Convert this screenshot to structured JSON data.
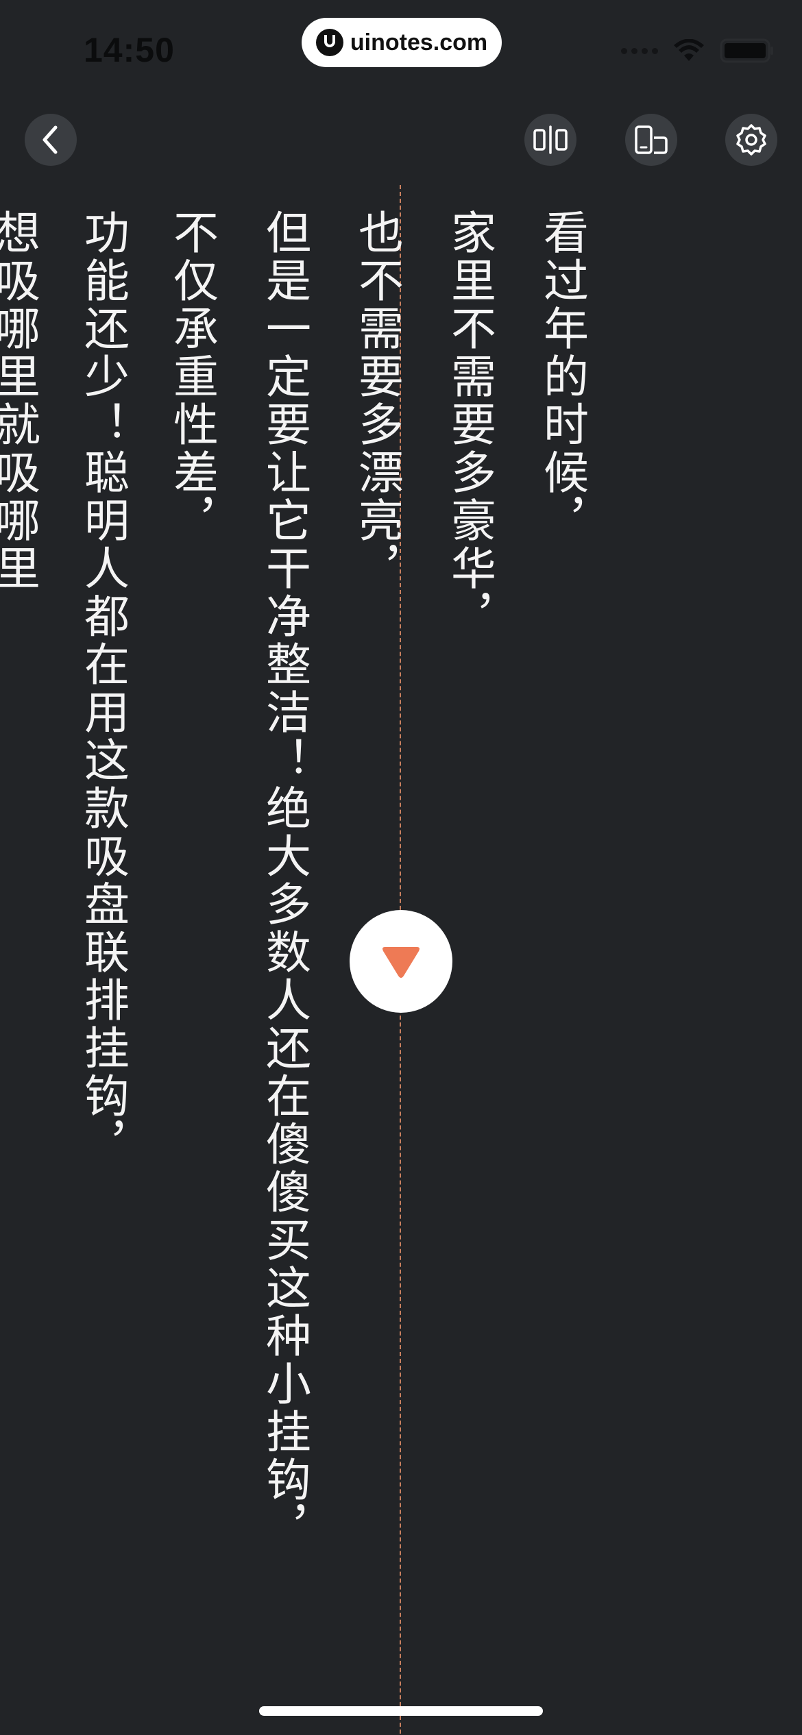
{
  "status_bar": {
    "time": "14:50"
  },
  "watermark": {
    "text": "uinotes.com"
  },
  "toolbar": {
    "back_icon": "chevron-left-icon",
    "icons": [
      "mirror-icon",
      "rotate-device-icon",
      "settings-icon"
    ]
  },
  "teleprompter": {
    "lines": [
      "看过年的时候，",
      "家里不需要多豪华，",
      "也不需要多漂亮，",
      "但是一定要让它干净整洁！绝大多数人还在傻傻买这种小挂钩，",
      "不仅承重性差，",
      "功能还少！聪明人都在用这款吸盘联排挂钩，",
      "想吸哪里就吸哪里"
    ],
    "scroll_icon": "play-down-icon"
  },
  "colors": {
    "background": "#222427",
    "text": "#f4f4f4",
    "accent": "#ee7a55",
    "guide": "#c9805f"
  }
}
